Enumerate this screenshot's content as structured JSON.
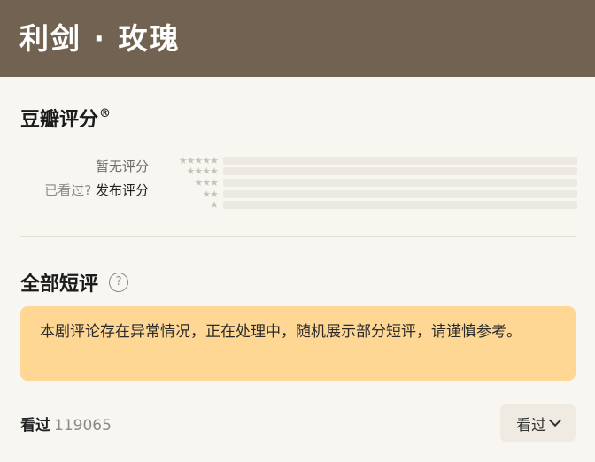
{
  "header": {
    "title": "利剑 · 玫瑰"
  },
  "rating": {
    "title": "豆瓣评分",
    "trademark": "®",
    "no_rating_text": "暂无评分",
    "seen_prompt": "已看过?",
    "publish_link": "发布评分",
    "star_rows": [
      {
        "stars": "★★★★★",
        "fraction": 0
      },
      {
        "stars": "★★★★",
        "fraction": 0
      },
      {
        "stars": "★★★",
        "fraction": 0
      },
      {
        "stars": "★★",
        "fraction": 0
      },
      {
        "stars": "★",
        "fraction": 0
      }
    ]
  },
  "reviews": {
    "title": "全部短评",
    "help_symbol": "?",
    "notice": "本剧评论存在异常情况，正在处理中，随机展示部分短评，请谨慎参考。",
    "watched_label": "看过",
    "watched_count": "119065",
    "filter_label": "看过"
  },
  "colors": {
    "header_bg": "#716251",
    "notice_bg": "#fed795",
    "page_bg": "#f8f6f1"
  }
}
